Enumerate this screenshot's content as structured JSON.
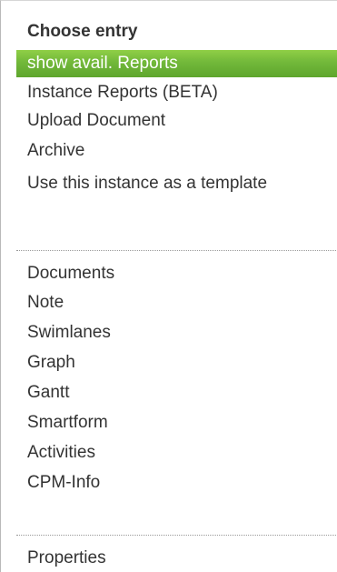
{
  "menu": {
    "header": "Choose entry",
    "items": [
      {
        "label": "show avail. Reports",
        "active": true
      },
      {
        "label": "Instance Reports (BETA)"
      },
      {
        "label": "Upload Document"
      },
      {
        "label": "Archive"
      },
      {
        "label": "Use this instance as a template"
      },
      {
        "label": "Documents"
      },
      {
        "label": "Note"
      },
      {
        "label": "Swimlanes"
      },
      {
        "label": "Graph"
      },
      {
        "label": "Gantt"
      },
      {
        "label": "Smartform"
      },
      {
        "label": "Activities"
      },
      {
        "label": "CPM-Info"
      },
      {
        "label": "Properties"
      }
    ]
  },
  "colors": {
    "active_bg": "#72b83a",
    "active_text": "#ffffff",
    "text": "#333333",
    "separator": "#9a9a9a"
  }
}
